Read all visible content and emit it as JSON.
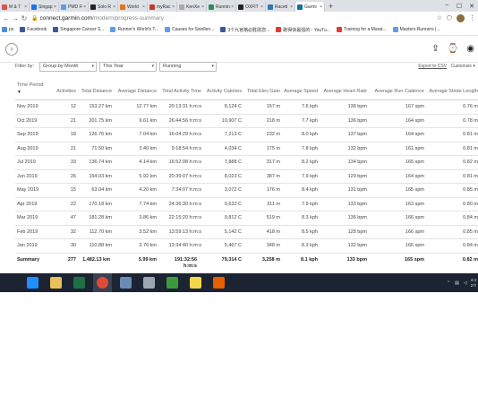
{
  "browser": {
    "tabs": [
      {
        "label": "M & T",
        "color": "#d9534f"
      },
      {
        "label": "Singap",
        "color": "#1a73e8"
      },
      {
        "label": "PMD Fi",
        "color": "#5c9ded"
      },
      {
        "label": "Solo R",
        "color": "#222222"
      },
      {
        "label": "World",
        "color": "#e8711a"
      },
      {
        "label": "myRac",
        "color": "#c0392b"
      },
      {
        "label": "KenXe",
        "color": "#aaaaaa"
      },
      {
        "label": "Runnin",
        "color": "#2e8b57"
      },
      {
        "label": "OXFIT",
        "color": "#222222"
      },
      {
        "label": "Raceti",
        "color": "#2a7ab8"
      },
      {
        "label": "Garmi",
        "color": "#11729f",
        "active": true
      }
    ],
    "new_tab": "+",
    "window_controls": [
      "−",
      "☐",
      "✕"
    ],
    "url_host": "connect.garmin.com",
    "url_path": "/modern/progress-summary",
    "bookmarks": [
      {
        "label": "ps",
        "color": "#4a90d9"
      },
      {
        "label": "Facebook",
        "color": "#3b5998"
      },
      {
        "label": "Singapore Cancer S...",
        "color": "#3b5998"
      },
      {
        "label": "Runner's World's T...",
        "color": "#5c9ded"
      },
      {
        "label": "Causes for Swollen...",
        "color": "#5c9ded"
      },
      {
        "label": "3个九宫格必胜助您...",
        "color": "#3b5998"
      },
      {
        "label": "跑得快最强的 - YouTu...",
        "color": "#e53935"
      },
      {
        "label": "Training for a Marat...",
        "color": "#e53935"
      },
      {
        "label": "Masters Runners |...",
        "color": "#5c9ded"
      }
    ]
  },
  "header": {
    "expand_icon": "›"
  },
  "filters": {
    "label": "Filter by:",
    "group": "Group by Month",
    "period": "This Year",
    "activity": "Running",
    "export": "Export to CSV",
    "customize": "Customize"
  },
  "table": {
    "headers": [
      "Time Period",
      "Activities",
      "Total Distance",
      "Average Distance",
      "Total Activity Time",
      "Activity Calories",
      "Total Elev Gain",
      "Average Speed",
      "Average Heart Rate",
      "Average Run Cadence",
      "Average Stride Length"
    ],
    "sort_indicator": "▼",
    "rows": [
      [
        "Nov 2019",
        "12",
        "153.27 km",
        "12.77 km",
        "20:13:31 h:m:s",
        "8,124 C",
        "157 m",
        "7.6 kph",
        "138 bpm",
        "167 spm",
        "0.76 m"
      ],
      [
        "Oct 2019",
        "21",
        "201.75 km",
        "9.61 km",
        "26:44:56 h:m:s",
        "10,907 C",
        "218 m",
        "7.7 kph",
        "136 bpm",
        "164 spm",
        "0.78 m"
      ],
      [
        "Sep 2019",
        "18",
        "126.76 km",
        "7.04 km",
        "16:04:29 h:m:s",
        "7,213 C",
        "232 m",
        "8.0 kph",
        "137 bpm",
        "164 spm",
        "0.81 m"
      ],
      [
        "Aug 2019",
        "21",
        "71.50 km",
        "3.40 km",
        "9:18:54 h:m:s",
        "4,034 C",
        "175 m",
        "7.8 kph",
        "132 bpm",
        "161 spm",
        "0.81 m"
      ],
      [
        "Jul 2019",
        "33",
        "136.74 km",
        "4.14 km",
        "16:52:08 h:m:s",
        "7,888 C",
        "317 m",
        "8.2 kph",
        "134 bpm",
        "165 spm",
        "0.82 m"
      ],
      [
        "Jun 2019",
        "26",
        "154.03 km",
        "5.92 km",
        "20:39:07 h:m:s",
        "8,023 C",
        "387 m",
        "7.9 kph",
        "129 bpm",
        "164 spm",
        "0.81 m"
      ],
      [
        "May 2019",
        "15",
        "63.04 km",
        "4.20 km",
        "7:34:07 h:m:s",
        "3,072 C",
        "176 m",
        "8.4 kph",
        "131 bpm",
        "165 spm",
        "0.85 m"
      ],
      [
        "Apr 2019",
        "22",
        "170.18 km",
        "7.74 km",
        "24:36:30 h:m:s",
        "9,632 C",
        "311 m",
        "7.9 kph",
        "133 bpm",
        "163 spm",
        "0.80 m"
      ],
      [
        "Mar 2019",
        "47",
        "181.28 km",
        "3.86 km",
        "22:15:20 h:m:s",
        "9,812 C",
        "519 m",
        "8.3 kph",
        "136 bpm",
        "166 spm",
        "0.84 m"
      ],
      [
        "Feb 2019",
        "32",
        "112.70 km",
        "3.52 km",
        "13:59:13 h:m:s",
        "5,142 C",
        "418 m",
        "8.5 kph",
        "128 bpm",
        "166 spm",
        "0.85 m"
      ],
      [
        "Jan 2019",
        "30",
        "110.88 km",
        "3.70 km",
        "13:34:40 h:m:s",
        "5,467 C",
        "348 m",
        "8.3 kph",
        "132 bpm",
        "166 spm",
        "0.84 m"
      ]
    ],
    "summary": [
      "Summary",
      "277",
      "1,482.13 km",
      "5.99 km",
      "191:32:56 h:m:s",
      "79,314 C",
      "3,258 m",
      "8.1 kph",
      "133 bpm",
      "165 spm",
      "0.82 m"
    ]
  },
  "taskbar": {
    "apps": [
      {
        "name": "ie",
        "color": "#1e90ff"
      },
      {
        "name": "explorer",
        "color": "#e8c15a"
      },
      {
        "name": "excel",
        "color": "#1e7145"
      },
      {
        "name": "chrome",
        "color": "#dd4b39",
        "active": true
      },
      {
        "name": "photos",
        "color": "#6a8bb5"
      },
      {
        "name": "tool",
        "color": "#9aa6b2"
      },
      {
        "name": "calculator",
        "color": "#3c9c3c"
      },
      {
        "name": "notes",
        "color": "#f2d64b"
      },
      {
        "name": "firefox",
        "color": "#e66000"
      }
    ],
    "time": "4:4",
    "date": "27/"
  }
}
